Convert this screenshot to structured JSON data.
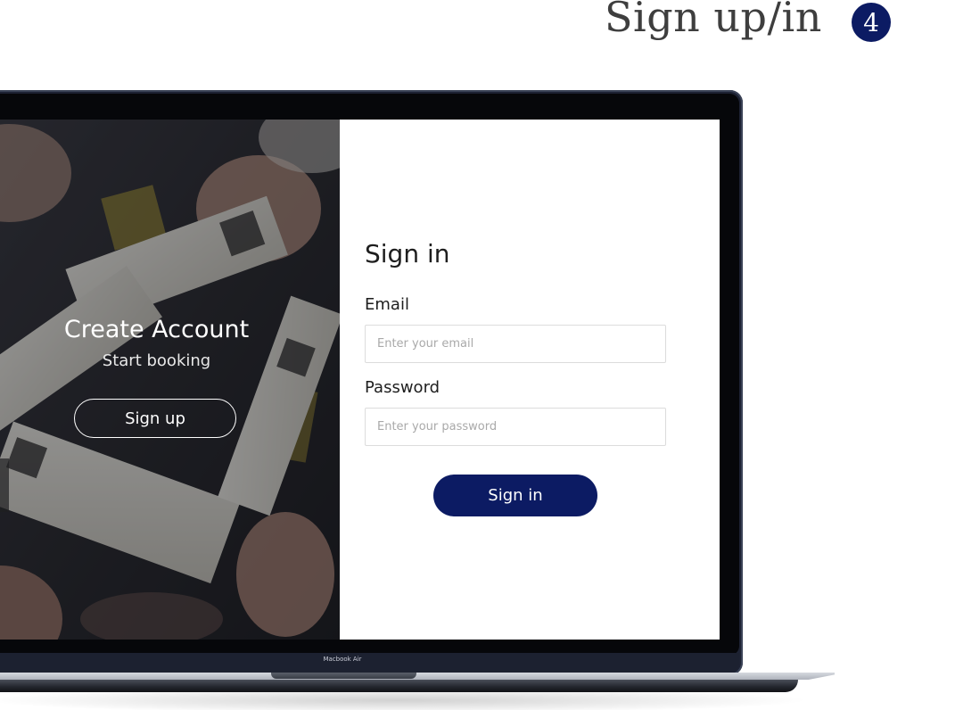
{
  "slide": {
    "title": "Sign up/in",
    "step_number": "4"
  },
  "device": {
    "model_label": "Macbook Air"
  },
  "hero": {
    "title": "Create Account",
    "subtitle": "Start booking",
    "signup_button_label": "Sign up"
  },
  "signin_form": {
    "heading": "Sign in",
    "email_label": "Email",
    "email_placeholder": "Enter your email",
    "email_value": "",
    "password_label": "Password",
    "password_placeholder": "Enter your password",
    "password_value": "",
    "submit_label": "Sign in"
  },
  "colors": {
    "brand_navy": "#0c1b63",
    "title_gray": "#3e3e3e",
    "input_border": "#dcdcdc",
    "placeholder": "#a9a9a9"
  }
}
